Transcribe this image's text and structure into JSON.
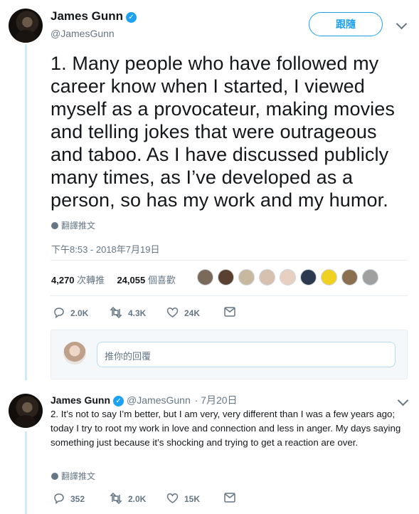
{
  "tweet": {
    "author_name": "James Gunn",
    "handle": "@JamesGunn",
    "follow_label": "跟隨",
    "text": "1. Many people who have followed my career know when I started, I viewed myself as a provocateur, making movies and telling jokes that were outrageous and taboo. As I have discussed publicly many times, as I’ve developed as a person, so has my work and my humor.",
    "translate_label": "翻譯推文",
    "timestamp": "下午8:53 - 2018年7月19日",
    "retweets_count": "4,270",
    "retweets_label": "次轉推",
    "likes_count": "24,055",
    "likes_label": "個喜歡",
    "reply_count": "2.0K",
    "retweet_count_short": "4.3K",
    "like_count_short": "24K"
  },
  "reply_box": {
    "placeholder": "推你的回覆"
  },
  "reply_tweet": {
    "author_name": "James Gunn",
    "handle": "@JamesGunn",
    "date": "· 7月20日",
    "text": "2. It’s not to say I’m better, but I am very, very different than I was a few years ago; today I try to root my work in love and connection and less in anger.  My days saying something just because it’s shocking and trying to get a reaction are over.",
    "translate_label": "翻譯推文",
    "reply_count": "352",
    "retweet_count": "2.0K",
    "like_count": "15K"
  },
  "colors": {
    "accent": "#1da1f2",
    "muted": "#657786",
    "thread_line": "#cdebfa"
  },
  "likers_avatars": [
    "liker-1",
    "liker-2",
    "liker-3",
    "liker-4",
    "liker-5",
    "liker-6",
    "liker-7",
    "liker-8",
    "liker-9"
  ]
}
